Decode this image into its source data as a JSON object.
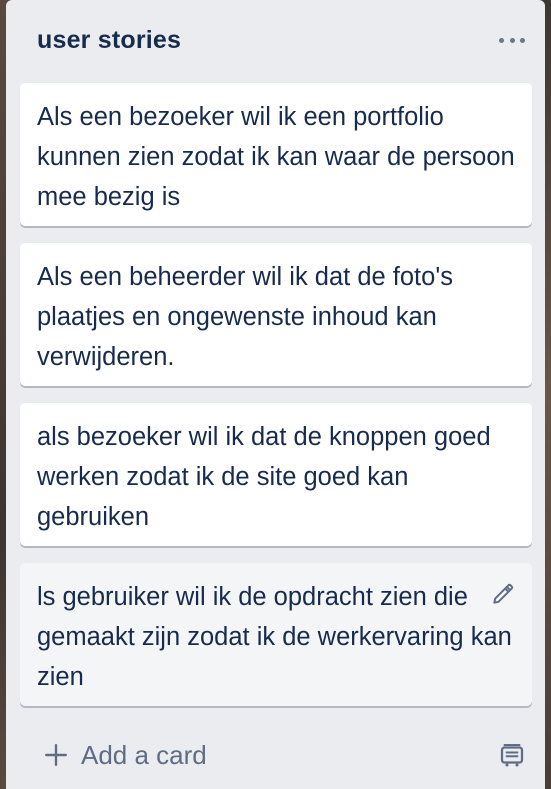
{
  "list": {
    "title": "user stories",
    "menu_icon": "ellipsis-icon",
    "cards": [
      {
        "text": "Als een bezoeker wil ik een portfolio kunnen zien zodat ik kan waar de persoon mee bezig is"
      },
      {
        "text": "Als een beheerder wil ik dat de foto's plaatjes en ongewenste inhoud kan verwijderen."
      },
      {
        "text": "als bezoeker wil ik dat de knoppen goed werken zodat ik de site goed kan gebruiken"
      },
      {
        "text": "ls gebruiker wil ik de opdracht zien die gemaakt zijn zodat ik de werkervaring kan zien",
        "hovered": true,
        "icon": "pencil-icon"
      }
    ],
    "add_card_label": "Add a card",
    "add_card_icon": "plus-icon",
    "template_icon": "card-template-icon"
  },
  "colors": {
    "list_bg": "#ebecf0",
    "card_bg": "#ffffff",
    "card_hover_bg": "#f4f5f7",
    "text": "#172b4d",
    "muted": "#5e6c84"
  }
}
